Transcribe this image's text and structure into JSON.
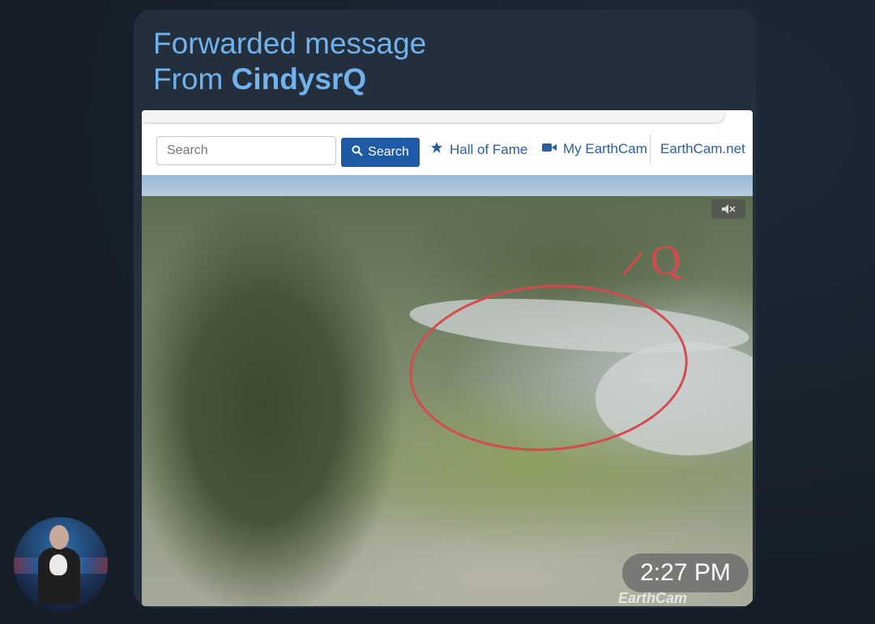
{
  "message": {
    "forwarded_label": "Forwarded message",
    "from_prefix": "From",
    "sender": "CindysrQ",
    "time": "2:27 PM"
  },
  "screenshot": {
    "search_placeholder": "Search",
    "search_button": "Search",
    "links": [
      {
        "label": "Hall of Fame",
        "icon": "star-icon"
      },
      {
        "label": "My EarthCam",
        "icon": "video-camera-icon"
      },
      {
        "label": "EarthCam.net"
      }
    ],
    "annotation_text": "Q",
    "watermark": "EarthCam"
  },
  "colors": {
    "accent": "#71b2ec",
    "bubble": "#232f3d",
    "background": "#17212b",
    "earthcam_blue": "#1f5aa6",
    "annotation_red": "#d54a4f"
  }
}
